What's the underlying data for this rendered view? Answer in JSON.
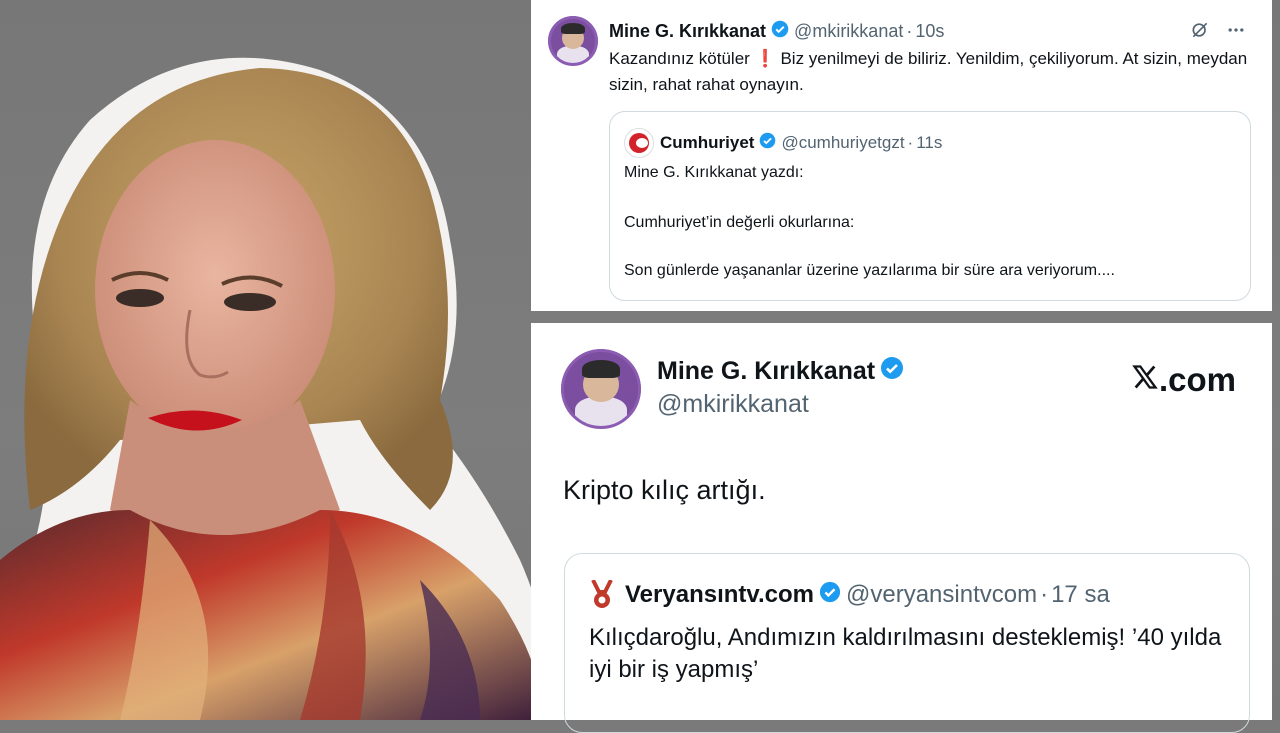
{
  "top_tweet": {
    "author_name": "Mine G. Kırıkkanat",
    "handle": "@mkirikkanat",
    "separator": "·",
    "time": "10s",
    "text_a": "Kazandınız kötüler",
    "text_b": " Biz yenilmeyi de biliriz. Yenildim, çekiliyorum. At sizin, meydan sizin, rahat rahat  oynayın.",
    "more_icon": "more-horizontal-icon",
    "grok_icon": "grok-icon",
    "quote": {
      "author_name": "Cumhuriyet",
      "handle": "@cumhuriyetgzt",
      "separator": "·",
      "time": "11s",
      "line1": "Mine G. Kırıkkanat yazdı:",
      "line2": "Cumhuriyet’in değerli okurlarına:",
      "line3": "Son günlerde yaşananlar üzerine yazılarıma bir süre ara veriyorum...."
    }
  },
  "bottom_tweet": {
    "author_name": "Mine G. Kırıkkanat",
    "handle": "@mkirikkanat",
    "brand": ".com",
    "text": "Kripto kılıç artığı.",
    "quote": {
      "author_name": "Veryansıntv.com",
      "handle": "@veryansintvcom",
      "separator": "·",
      "time": "17 sa",
      "text": "Kılıçdaroğlu, Andımızın kaldırılmasını desteklemiş! ’40 yılda iyi bir iş yapmış’"
    }
  },
  "colors": {
    "verified": "#1d9bf0",
    "cumhuriyet": "#d2232a",
    "accent_purple": "#7b4ea0"
  }
}
